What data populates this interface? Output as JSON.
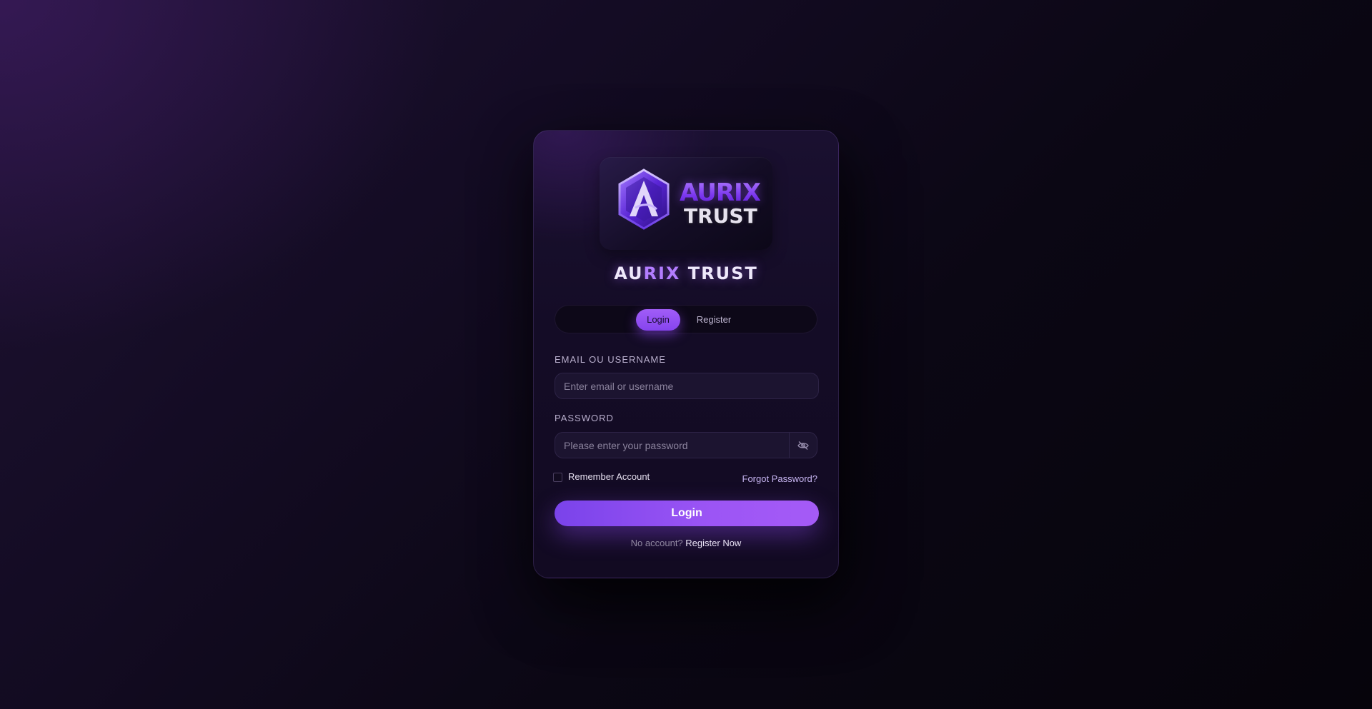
{
  "brand": {
    "logo_word_1": "AURIX",
    "logo_word_2": "TRUST",
    "title_part_1": "AU",
    "title_accent": "RIX",
    "title_part_2": " TRUST"
  },
  "tabs": {
    "login": "Login",
    "register": "Register",
    "active": "login"
  },
  "form": {
    "email_label": "EMAIL OU USERNAME",
    "email_placeholder": "Enter email or username",
    "email_value": "",
    "password_label": "PASSWORD",
    "password_placeholder": "Please enter your password",
    "password_value": "",
    "remember_label": "Remember Account",
    "remember_checked": false,
    "forgot_label": "Forgot Password?",
    "submit_label": "Login"
  },
  "footer": {
    "prompt": "No account?",
    "link": "Register Now"
  },
  "colors": {
    "accent": "#9c55f5",
    "accent_dark": "#7a43ea",
    "background": "#0b0714"
  },
  "icons": {
    "logo": "hexagon-a-logo-icon",
    "password_toggle": "eye-off-icon"
  }
}
